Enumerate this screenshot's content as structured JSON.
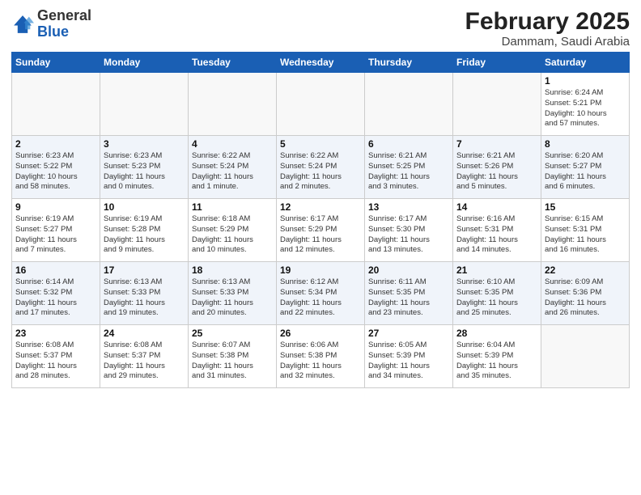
{
  "header": {
    "logo_general": "General",
    "logo_blue": "Blue",
    "month_year": "February 2025",
    "location": "Dammam, Saudi Arabia"
  },
  "weekdays": [
    "Sunday",
    "Monday",
    "Tuesday",
    "Wednesday",
    "Thursday",
    "Friday",
    "Saturday"
  ],
  "weeks": [
    [
      {
        "day": "",
        "info": ""
      },
      {
        "day": "",
        "info": ""
      },
      {
        "day": "",
        "info": ""
      },
      {
        "day": "",
        "info": ""
      },
      {
        "day": "",
        "info": ""
      },
      {
        "day": "",
        "info": ""
      },
      {
        "day": "1",
        "info": "Sunrise: 6:24 AM\nSunset: 5:21 PM\nDaylight: 10 hours\nand 57 minutes."
      }
    ],
    [
      {
        "day": "2",
        "info": "Sunrise: 6:23 AM\nSunset: 5:22 PM\nDaylight: 10 hours\nand 58 minutes."
      },
      {
        "day": "3",
        "info": "Sunrise: 6:23 AM\nSunset: 5:23 PM\nDaylight: 11 hours\nand 0 minutes."
      },
      {
        "day": "4",
        "info": "Sunrise: 6:22 AM\nSunset: 5:24 PM\nDaylight: 11 hours\nand 1 minute."
      },
      {
        "day": "5",
        "info": "Sunrise: 6:22 AM\nSunset: 5:24 PM\nDaylight: 11 hours\nand 2 minutes."
      },
      {
        "day": "6",
        "info": "Sunrise: 6:21 AM\nSunset: 5:25 PM\nDaylight: 11 hours\nand 3 minutes."
      },
      {
        "day": "7",
        "info": "Sunrise: 6:21 AM\nSunset: 5:26 PM\nDaylight: 11 hours\nand 5 minutes."
      },
      {
        "day": "8",
        "info": "Sunrise: 6:20 AM\nSunset: 5:27 PM\nDaylight: 11 hours\nand 6 minutes."
      }
    ],
    [
      {
        "day": "9",
        "info": "Sunrise: 6:19 AM\nSunset: 5:27 PM\nDaylight: 11 hours\nand 7 minutes."
      },
      {
        "day": "10",
        "info": "Sunrise: 6:19 AM\nSunset: 5:28 PM\nDaylight: 11 hours\nand 9 minutes."
      },
      {
        "day": "11",
        "info": "Sunrise: 6:18 AM\nSunset: 5:29 PM\nDaylight: 11 hours\nand 10 minutes."
      },
      {
        "day": "12",
        "info": "Sunrise: 6:17 AM\nSunset: 5:29 PM\nDaylight: 11 hours\nand 12 minutes."
      },
      {
        "day": "13",
        "info": "Sunrise: 6:17 AM\nSunset: 5:30 PM\nDaylight: 11 hours\nand 13 minutes."
      },
      {
        "day": "14",
        "info": "Sunrise: 6:16 AM\nSunset: 5:31 PM\nDaylight: 11 hours\nand 14 minutes."
      },
      {
        "day": "15",
        "info": "Sunrise: 6:15 AM\nSunset: 5:31 PM\nDaylight: 11 hours\nand 16 minutes."
      }
    ],
    [
      {
        "day": "16",
        "info": "Sunrise: 6:14 AM\nSunset: 5:32 PM\nDaylight: 11 hours\nand 17 minutes."
      },
      {
        "day": "17",
        "info": "Sunrise: 6:13 AM\nSunset: 5:33 PM\nDaylight: 11 hours\nand 19 minutes."
      },
      {
        "day": "18",
        "info": "Sunrise: 6:13 AM\nSunset: 5:33 PM\nDaylight: 11 hours\nand 20 minutes."
      },
      {
        "day": "19",
        "info": "Sunrise: 6:12 AM\nSunset: 5:34 PM\nDaylight: 11 hours\nand 22 minutes."
      },
      {
        "day": "20",
        "info": "Sunrise: 6:11 AM\nSunset: 5:35 PM\nDaylight: 11 hours\nand 23 minutes."
      },
      {
        "day": "21",
        "info": "Sunrise: 6:10 AM\nSunset: 5:35 PM\nDaylight: 11 hours\nand 25 minutes."
      },
      {
        "day": "22",
        "info": "Sunrise: 6:09 AM\nSunset: 5:36 PM\nDaylight: 11 hours\nand 26 minutes."
      }
    ],
    [
      {
        "day": "23",
        "info": "Sunrise: 6:08 AM\nSunset: 5:37 PM\nDaylight: 11 hours\nand 28 minutes."
      },
      {
        "day": "24",
        "info": "Sunrise: 6:08 AM\nSunset: 5:37 PM\nDaylight: 11 hours\nand 29 minutes."
      },
      {
        "day": "25",
        "info": "Sunrise: 6:07 AM\nSunset: 5:38 PM\nDaylight: 11 hours\nand 31 minutes."
      },
      {
        "day": "26",
        "info": "Sunrise: 6:06 AM\nSunset: 5:38 PM\nDaylight: 11 hours\nand 32 minutes."
      },
      {
        "day": "27",
        "info": "Sunrise: 6:05 AM\nSunset: 5:39 PM\nDaylight: 11 hours\nand 34 minutes."
      },
      {
        "day": "28",
        "info": "Sunrise: 6:04 AM\nSunset: 5:39 PM\nDaylight: 11 hours\nand 35 minutes."
      },
      {
        "day": "",
        "info": ""
      }
    ]
  ]
}
